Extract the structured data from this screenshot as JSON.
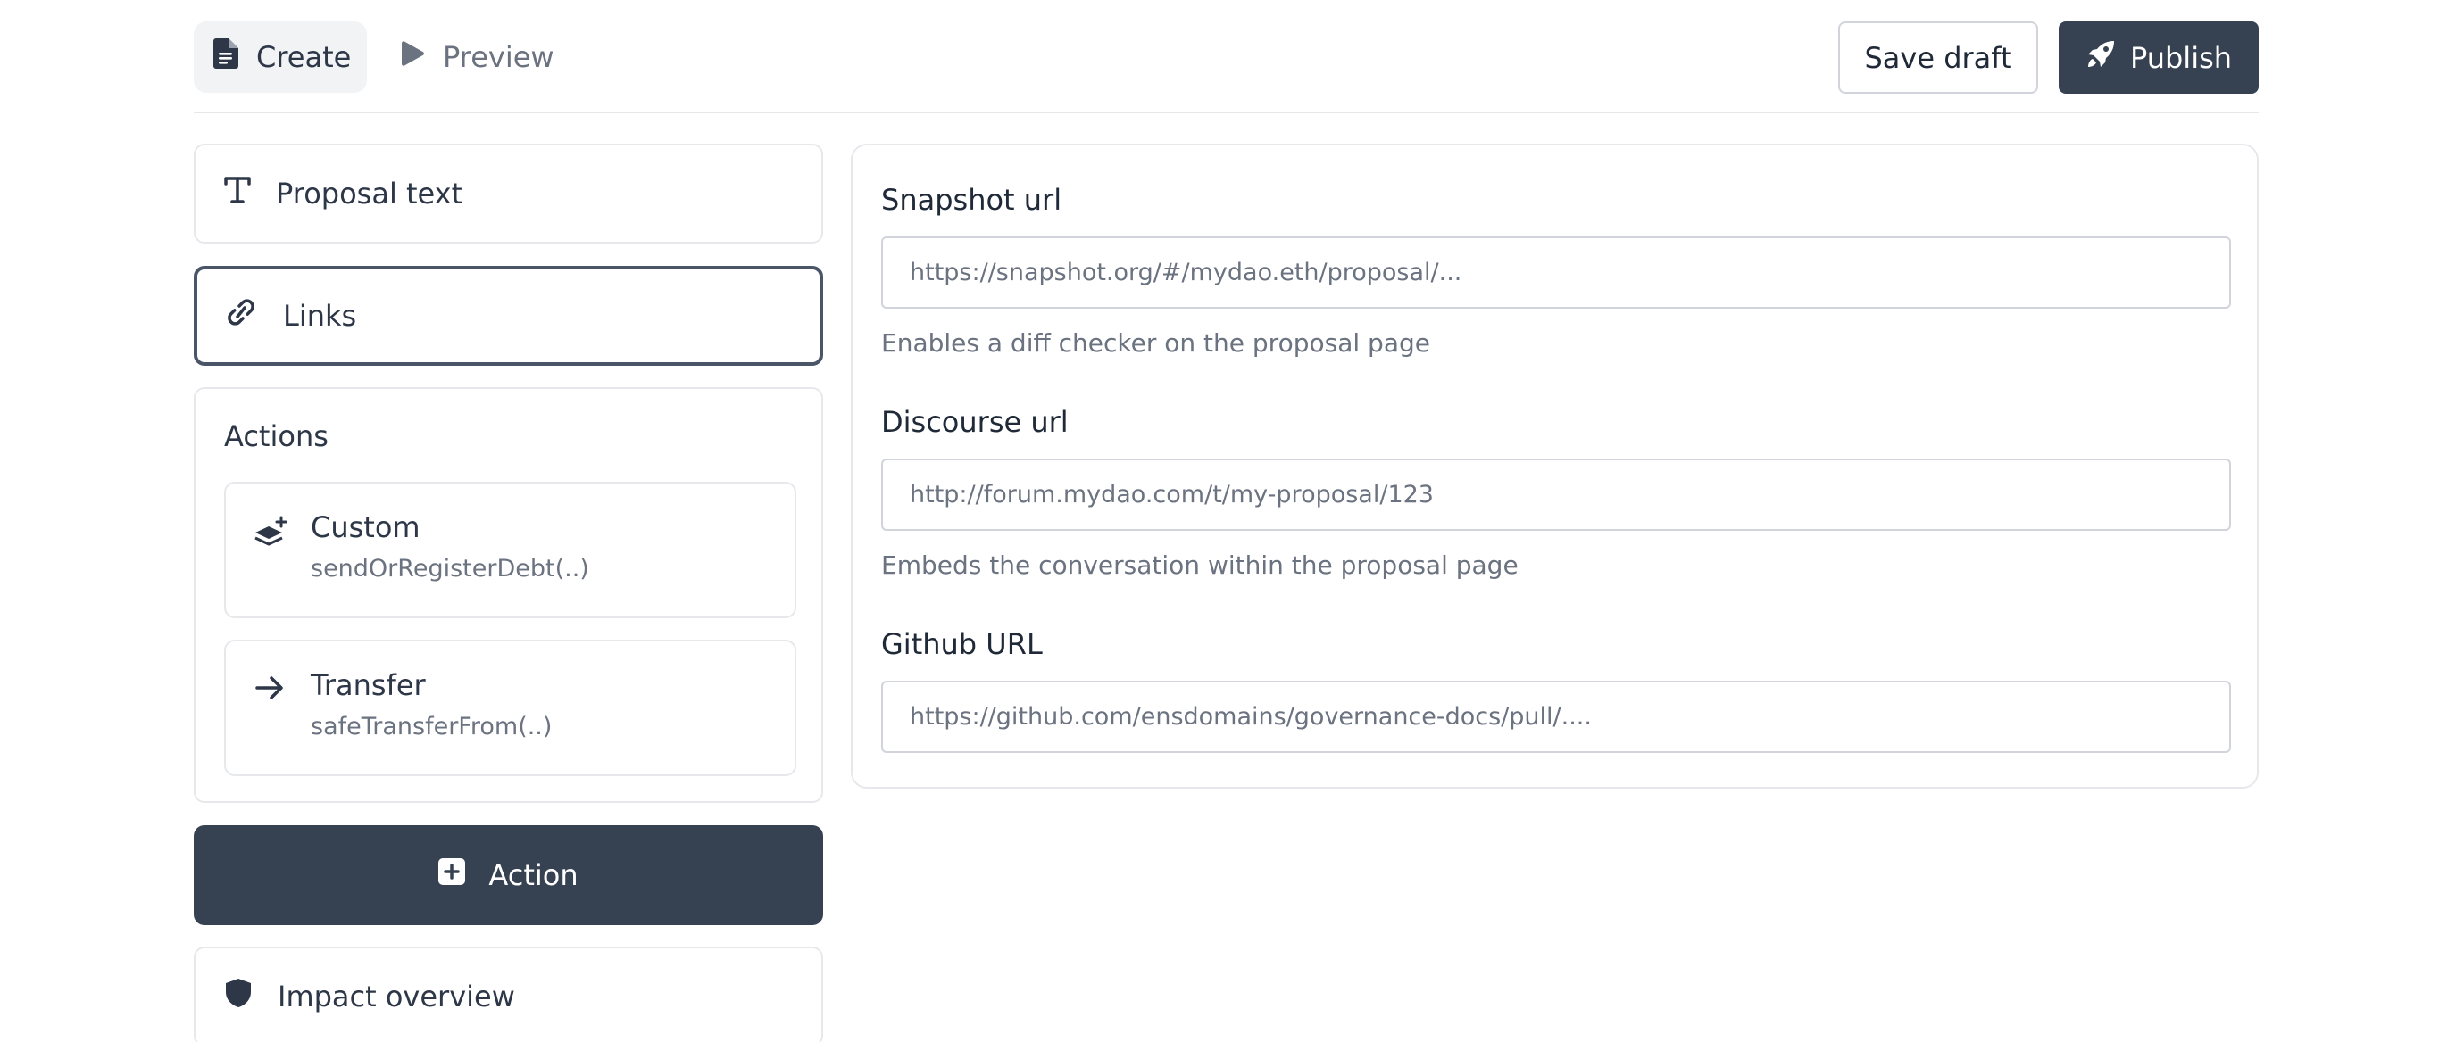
{
  "header": {
    "tabs": [
      {
        "label": "Create",
        "icon": "document-icon",
        "active": true
      },
      {
        "label": "Preview",
        "icon": "play-icon",
        "active": false
      }
    ],
    "save_draft_label": "Save draft",
    "publish_label": "Publish",
    "publish_icon": "rocket-icon"
  },
  "sidebar": {
    "proposal_text_label": "Proposal text",
    "links_label": "Links",
    "actions_title": "Actions",
    "actions": [
      {
        "name": "Custom",
        "function": "sendOrRegisterDebt(..)",
        "icon": "layers-plus-icon"
      },
      {
        "name": "Transfer",
        "function": "safeTransferFrom(..)",
        "icon": "arrow-right-icon"
      }
    ],
    "add_action_label": "Action",
    "impact_overview_label": "Impact overview"
  },
  "links_form": {
    "fields": [
      {
        "label": "Snapshot url",
        "placeholder": "https://snapshot.org/#/mydao.eth/proposal/...",
        "help": "Enables a diff checker on the  proposal page"
      },
      {
        "label": "Discourse url",
        "placeholder": "http://forum.mydao.com/t/my-proposal/123",
        "help": "Embeds the conversation within the proposal page"
      },
      {
        "label": "Github URL",
        "placeholder": "https://github.com/ensdomains/governance-docs/pull/....",
        "help": ""
      }
    ]
  },
  "colors": {
    "primary_dark": "#364152",
    "border": "#e6e8eb",
    "muted_text": "#6b7280",
    "active_tab_bg": "#f1f3f5"
  }
}
